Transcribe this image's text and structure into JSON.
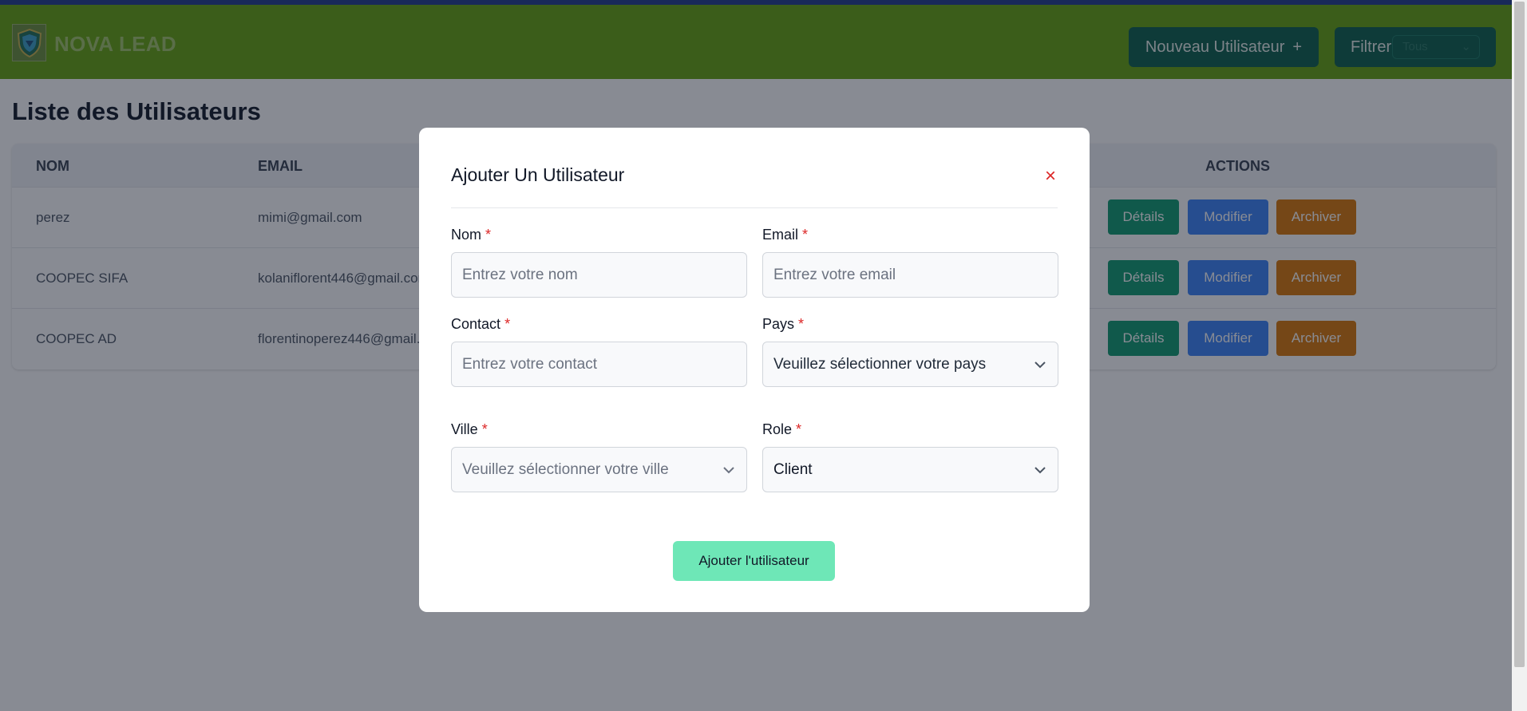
{
  "header": {
    "brand": "NOVA LEAD",
    "new_user_label": "Nouveau Utilisateur",
    "new_user_icon": "+",
    "filter_label": "Filtrer",
    "filter_select_value": "Tous"
  },
  "page": {
    "title": "Liste des Utilisateurs"
  },
  "table": {
    "columns": [
      "NOM",
      "EMAIL",
      "ACTIONS"
    ],
    "rows": [
      {
        "nom": "perez",
        "email": "mimi@gmail.com"
      },
      {
        "nom": "COOPEC SIFA",
        "email": "kolaniflorent446@gmail.com"
      },
      {
        "nom": "COOPEC AD",
        "email": "florentinoperez446@gmail.com"
      }
    ],
    "actions": {
      "details": "Détails",
      "modify": "Modifier",
      "archive": "Archiver"
    }
  },
  "modal": {
    "title": "Ajouter Un Utilisateur",
    "close_icon": "×",
    "required_mark": "*",
    "fields": {
      "nom": {
        "label": "Nom",
        "placeholder": "Entrez votre nom"
      },
      "email": {
        "label": "Email",
        "placeholder": "Entrez votre email"
      },
      "contact": {
        "label": "Contact",
        "placeholder": "Entrez votre contact"
      },
      "pays": {
        "label": "Pays",
        "value": "Veuillez sélectionner votre pays"
      },
      "ville": {
        "label": "Ville",
        "value": "Veuillez sélectionner votre ville"
      },
      "role": {
        "label": "Role",
        "value": "Client"
      }
    },
    "submit_label": "Ajouter l'utilisateur"
  },
  "colors": {
    "header_bg": "#65a30d",
    "primary_dark": "#0b5e4b",
    "details": "#0f9b6f",
    "modify": "#3b82f6",
    "archive": "#d97706",
    "submit": "#6ee7b7",
    "required": "#dc2626"
  }
}
